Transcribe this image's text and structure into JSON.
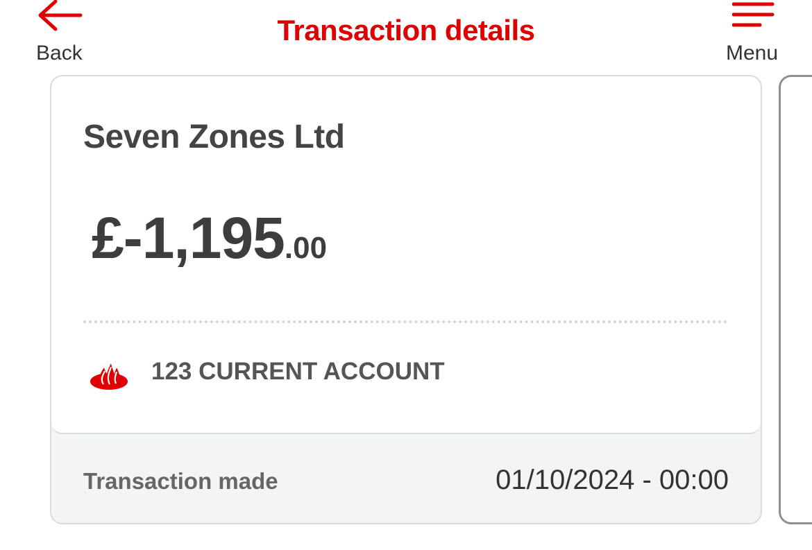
{
  "header": {
    "back_label": "Back",
    "title": "Transaction details",
    "menu_label": "Menu"
  },
  "transaction": {
    "merchant": "Seven Zones Ltd",
    "amount_main": "£-1,195",
    "amount_decimal": ".00",
    "account_icon": "santander-flame-icon",
    "account_name": "123 CURRENT ACCOUNT",
    "made_label": "Transaction made",
    "made_value": "01/10/2024 - 00:00"
  },
  "colors": {
    "brand_red": "#e00000",
    "text_dark": "#3d3d3d",
    "card_border": "#d7dcdc",
    "card_footer_bg": "#f3f4f6"
  }
}
